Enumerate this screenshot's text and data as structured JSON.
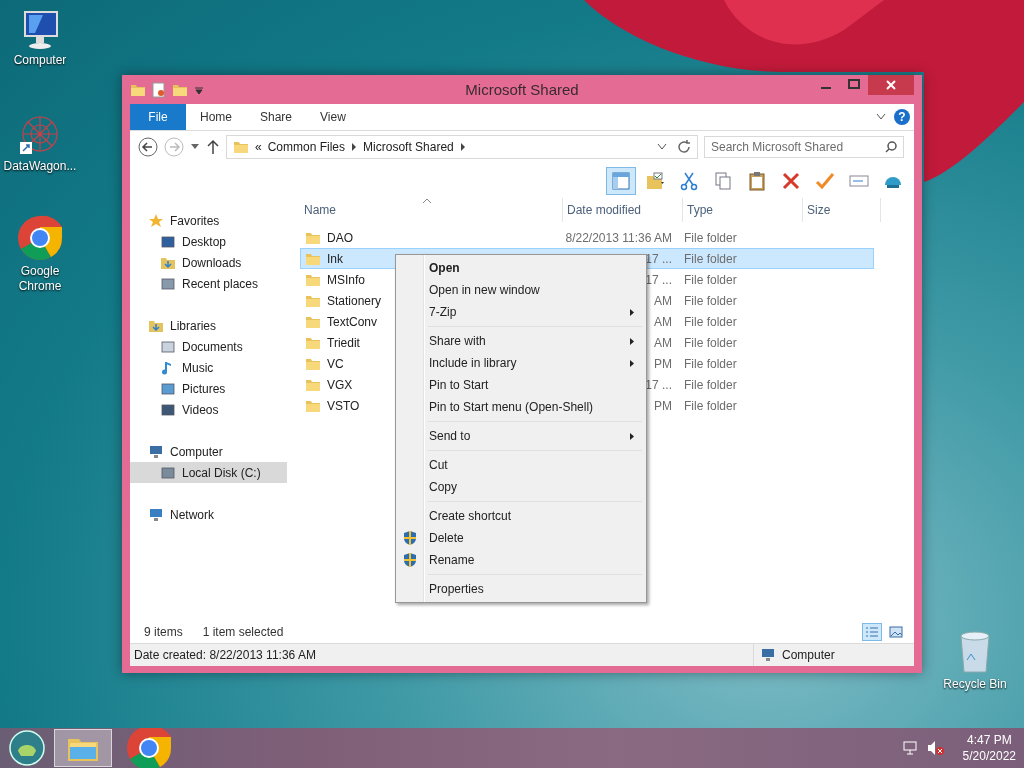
{
  "desktop_icons": [
    {
      "kind": "computer",
      "label": "Computer"
    },
    {
      "kind": "network-app",
      "label": "DataWagon..."
    },
    {
      "kind": "chrome",
      "label": "Google Chrome"
    },
    {
      "kind": "recycle",
      "label": "Recycle Bin"
    }
  ],
  "window": {
    "title": "Microsoft Shared",
    "ribbon_tabs": [
      {
        "kind": "file",
        "label": "File"
      },
      {
        "kind": "tab",
        "label": "Home"
      },
      {
        "kind": "tab",
        "label": "Share"
      },
      {
        "kind": "tab",
        "label": "View"
      }
    ],
    "address": {
      "overflow_mark": "«",
      "crumbs": [
        "Common Files",
        "Microsoft Shared"
      ]
    },
    "help": "?",
    "search": {
      "placeholder": "Search Microsoft Shared"
    },
    "command_buttons": [
      {
        "kind": "preview",
        "selected": true
      },
      {
        "kind": "properties",
        "selected": false
      },
      {
        "kind": "cut",
        "selected": false
      },
      {
        "kind": "copy",
        "selected": false
      },
      {
        "kind": "paste",
        "selected": false
      },
      {
        "kind": "delete",
        "selected": false
      },
      {
        "kind": "check",
        "selected": false
      },
      {
        "kind": "rename",
        "selected": false
      },
      {
        "kind": "shell",
        "selected": false
      }
    ],
    "nav": [
      {
        "label": "Favorites",
        "kind": "star",
        "selected": false,
        "children": [
          {
            "label": "Desktop",
            "kind": "desktop",
            "selected": false
          },
          {
            "label": "Downloads",
            "kind": "downloads",
            "selected": false
          },
          {
            "label": "Recent places",
            "kind": "recent",
            "selected": false
          }
        ]
      },
      {
        "label": "Libraries",
        "kind": "libraries",
        "selected": false,
        "children": [
          {
            "label": "Documents",
            "kind": "documents",
            "selected": false
          },
          {
            "label": "Music",
            "kind": "music",
            "selected": false
          },
          {
            "label": "Pictures",
            "kind": "pictures",
            "selected": false
          },
          {
            "label": "Videos",
            "kind": "videos",
            "selected": false
          }
        ]
      },
      {
        "label": "Computer",
        "kind": "computer",
        "selected": false,
        "children": [
          {
            "label": "Local Disk (C:)",
            "kind": "disk",
            "selected": true
          }
        ]
      },
      {
        "label": "Network",
        "kind": "network",
        "selected": false
      }
    ],
    "columns": [
      "Name",
      "Date modified",
      "Type",
      "Size"
    ],
    "rows": [
      {
        "name": "DAO",
        "date": "8/22/2013 11:36 AM",
        "type": "File folder",
        "selected": false
      },
      {
        "name": "Ink",
        "date": "17 ...",
        "type": "File folder",
        "selected": true
      },
      {
        "name": "MSInfo",
        "date": "17 ...",
        "type": "File folder",
        "selected": false
      },
      {
        "name": "Stationery",
        "date": "AM",
        "type": "File folder",
        "selected": false
      },
      {
        "name": "TextConv",
        "date": "AM",
        "type": "File folder",
        "selected": false
      },
      {
        "name": "Triedit",
        "date": "AM",
        "type": "File folder",
        "selected": false
      },
      {
        "name": "VC",
        "date": "PM",
        "type": "File folder",
        "selected": false
      },
      {
        "name": "VGX",
        "date": "17 ...",
        "type": "File folder",
        "selected": false
      },
      {
        "name": "VSTO",
        "date": "PM",
        "type": "File folder",
        "selected": false
      }
    ],
    "status": {
      "count": "9 items",
      "selection": "1 item selected"
    },
    "view_buttons": [
      {
        "kind": "details",
        "selected": true
      },
      {
        "kind": "thumbnails",
        "selected": false
      }
    ],
    "details_bar": {
      "text": "Date created: 8/22/2013 11:36 AM",
      "location": "Computer"
    }
  },
  "context_menu": {
    "groups": [
      [
        {
          "label": "Open",
          "default": true,
          "submenu": false,
          "shield": false
        },
        {
          "label": "Open in new window",
          "default": false,
          "submenu": false,
          "shield": false
        },
        {
          "label": "7-Zip",
          "default": false,
          "submenu": true,
          "shield": false
        }
      ],
      [
        {
          "label": "Share with",
          "default": false,
          "submenu": true,
          "shield": false
        },
        {
          "label": "Include in library",
          "default": false,
          "submenu": true,
          "shield": false
        },
        {
          "label": "Pin to Start",
          "default": false,
          "submenu": false,
          "shield": false
        },
        {
          "label": "Pin to Start menu (Open-Shell)",
          "default": false,
          "submenu": false,
          "shield": false
        }
      ],
      [
        {
          "label": "Send to",
          "default": false,
          "submenu": true,
          "shield": false
        }
      ],
      [
        {
          "label": "Cut",
          "default": false,
          "submenu": false,
          "shield": false
        },
        {
          "label": "Copy",
          "default": false,
          "submenu": false,
          "shield": false
        }
      ],
      [
        {
          "label": "Create shortcut",
          "default": false,
          "submenu": false,
          "shield": false
        },
        {
          "label": "Delete",
          "default": false,
          "submenu": false,
          "shield": true
        },
        {
          "label": "Rename",
          "default": false,
          "submenu": false,
          "shield": true
        }
      ],
      [
        {
          "label": "Properties",
          "default": false,
          "submenu": false,
          "shield": false
        }
      ]
    ]
  },
  "taskbar": {
    "buttons": [
      {
        "kind": "explorer",
        "selected": true
      },
      {
        "kind": "chrome",
        "selected": false
      }
    ],
    "time": "4:47 PM",
    "date": "5/20/2022"
  }
}
